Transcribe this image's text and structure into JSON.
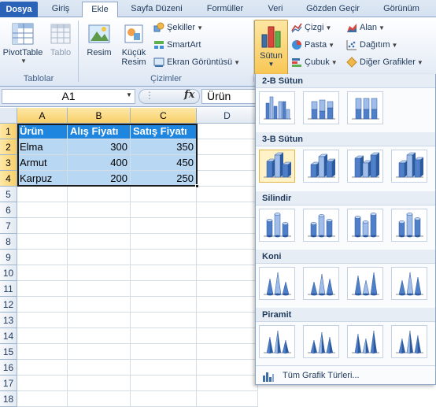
{
  "ribbon_tabs": [
    "Dosya",
    "Giriş",
    "Ekle",
    "Sayfa Düzeni",
    "Formüller",
    "Veri",
    "Gözden Geçir",
    "Görünüm"
  ],
  "active_tab": "Ekle",
  "groups": {
    "tablolar": {
      "label": "Tablolar",
      "pivot_label": "PivotTable",
      "tablo_label": "Tablo"
    },
    "cizimler": {
      "label": "Çizimler",
      "resim_label": "Resim",
      "kucuk_resim_label_1": "Küçük",
      "kucuk_resim_label_2": "Resim",
      "sekiller_label": "Şekiller",
      "smartart_label": "SmartArt",
      "ekran_label": "Ekran Görüntüsü"
    },
    "grafikler": {
      "sutun_label": "Sütun",
      "cizgi_label": "Çizgi",
      "pasta_label": "Pasta",
      "cubuk_label": "Çubuk",
      "alan_label": "Alan",
      "dagitim_label": "Dağıtım",
      "diger_label": "Diğer Grafikler"
    }
  },
  "formula_bar": {
    "name_box": "A1",
    "fx_label": "fx",
    "value": "Ürün"
  },
  "grid": {
    "columns": [
      "A",
      "B",
      "C",
      "D"
    ],
    "rows": [
      "1",
      "2",
      "3",
      "4",
      "5",
      "6",
      "7",
      "8",
      "9",
      "10",
      "11",
      "12",
      "13",
      "14",
      "15",
      "16",
      "17",
      "18"
    ],
    "cells": [
      [
        "Ürün",
        "Alış Fiyatı",
        "Satış Fiyatı"
      ],
      [
        "Elma",
        "300",
        "350"
      ],
      [
        "Armut",
        "400",
        "450"
      ],
      [
        "Karpuz",
        "200",
        "250"
      ]
    ]
  },
  "gallery": {
    "sections": [
      {
        "title": "2-B Sütun",
        "kind": "bar2d"
      },
      {
        "title": "3-B Sütun",
        "kind": "bar3d"
      },
      {
        "title": "Silindir",
        "kind": "cyl"
      },
      {
        "title": "Koni",
        "kind": "cone"
      },
      {
        "title": "Piramit",
        "kind": "pyr"
      }
    ],
    "all_types_label": "Tüm Grafik Türleri..."
  },
  "colors": {
    "file_tab": "#2a63b8",
    "header_cell": "#1f86e0",
    "body_cell": "#b8d7f3",
    "selected_header": "#f8cf68",
    "chart_blue": "#4f7fc9"
  }
}
